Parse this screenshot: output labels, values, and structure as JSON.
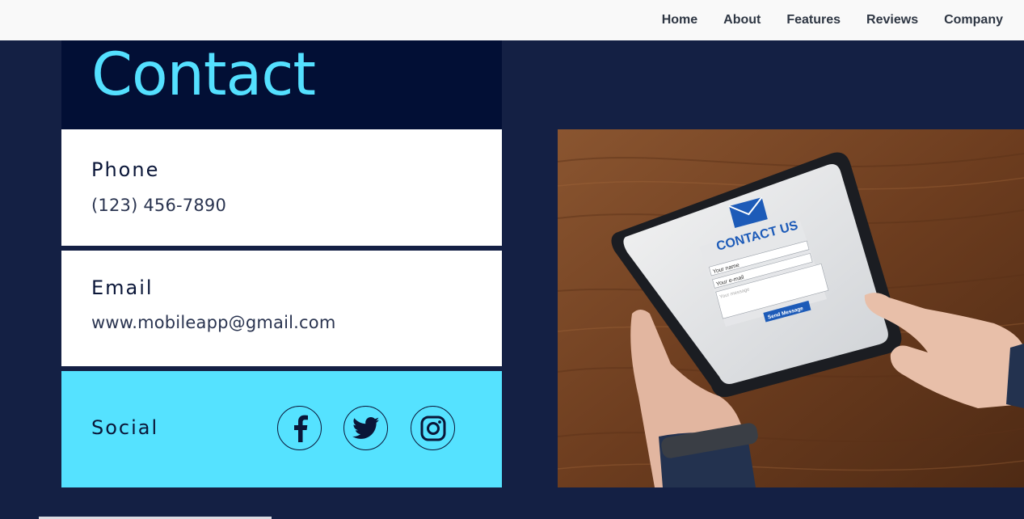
{
  "nav": {
    "items": [
      {
        "label": "Home"
      },
      {
        "label": "About"
      },
      {
        "label": "Features"
      },
      {
        "label": "Reviews"
      },
      {
        "label": "Company"
      }
    ]
  },
  "page": {
    "title": "Contact"
  },
  "contact": {
    "phone": {
      "label": "Phone",
      "value": "(123) 456-7890"
    },
    "email": {
      "label": "Email",
      "value": "www.mobileapp@gmail.com"
    },
    "social": {
      "label": "Social",
      "icons": [
        "facebook-icon",
        "twitter-icon",
        "instagram-icon"
      ]
    }
  },
  "image": {
    "tablet_heading": "CONTACT US",
    "name_placeholder": "Your name",
    "email_placeholder": "Your e-mail",
    "message_placeholder": "Your message",
    "send_label": "Send Message"
  },
  "colors": {
    "page_background": "#142044",
    "title_block": "#020f35",
    "accent": "#54e0ff",
    "nav_background": "#f9f9f9",
    "card_text": "#0a1638"
  }
}
